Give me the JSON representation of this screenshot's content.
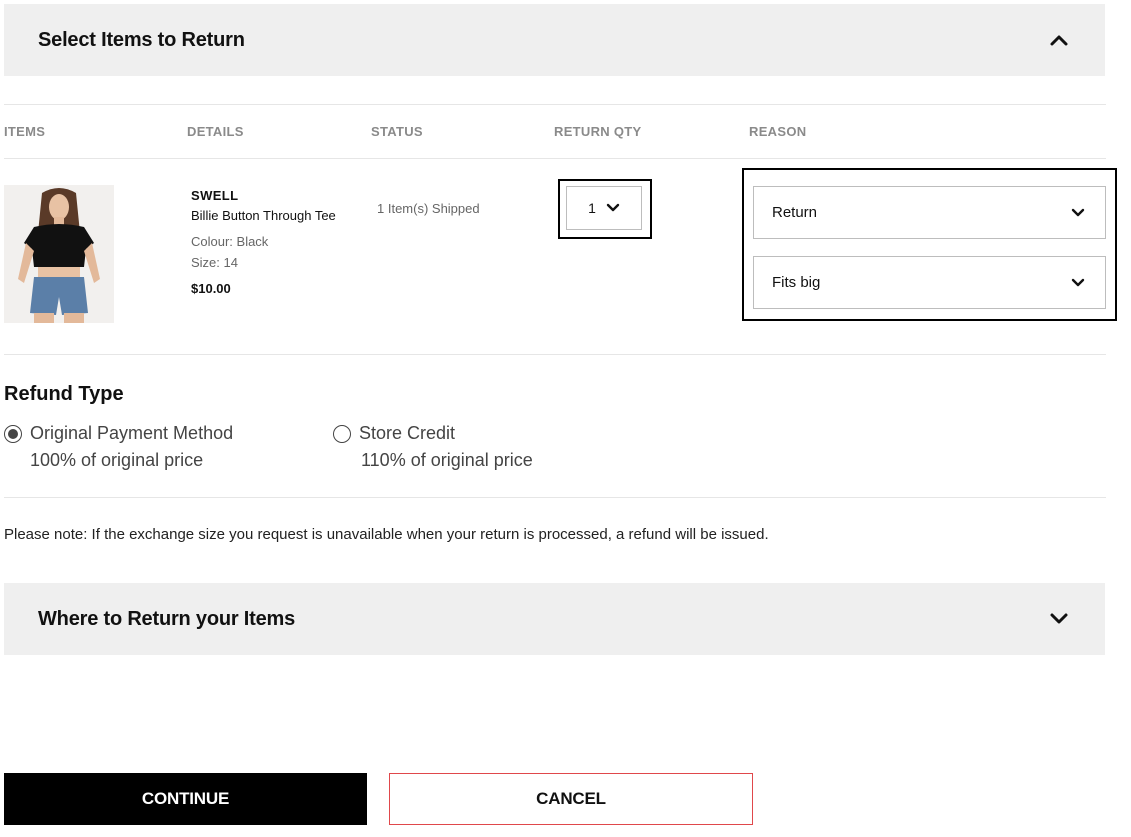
{
  "sections": {
    "select_items": {
      "title": "Select Items to Return",
      "expanded": true
    },
    "where_to_return": {
      "title": "Where to Return your Items",
      "expanded": false
    }
  },
  "table": {
    "headers": [
      "ITEMS",
      "DETAILS",
      "STATUS",
      "RETURN QTY",
      "REASON"
    ]
  },
  "item": {
    "brand": "SWELL",
    "name": "Billie Button Through Tee",
    "colour": "Colour: Black",
    "size": "Size: 14",
    "price": "$10.00",
    "status": "1 Item(s) Shipped",
    "return_qty": "1",
    "reason_type": "Return",
    "reason_detail": "Fits big"
  },
  "refund": {
    "title": "Refund Type",
    "options": [
      {
        "label": "Original Payment Method",
        "sub": "100% of original price",
        "selected": true
      },
      {
        "label": "Store Credit",
        "sub": "110% of original price",
        "selected": false
      }
    ]
  },
  "note": "Please note: If the exchange size you request is unavailable when your return is processed, a refund will be issued.",
  "buttons": {
    "continue": "CONTINUE",
    "cancel": "CANCEL"
  },
  "icons": {
    "expanded": "chevron-up-icon",
    "collapsed": "chevron-down-icon"
  },
  "colors": {
    "accordion_bg": "#efefef",
    "primary_button": "#000000",
    "cancel_border": "#e0484b"
  }
}
